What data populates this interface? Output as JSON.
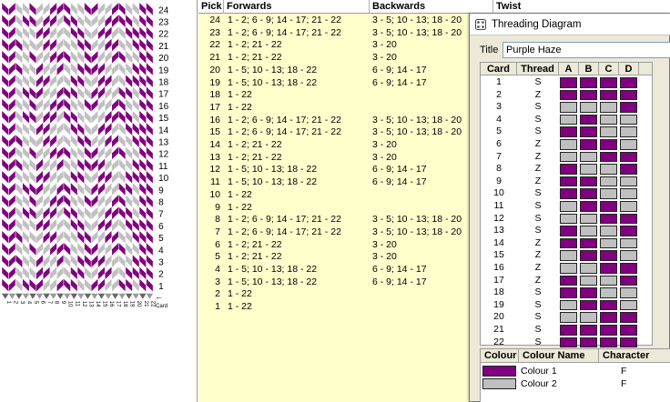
{
  "colors": {
    "purple": "#800080",
    "grey": "#c0c0c0",
    "table_bg": "#ffffcc"
  },
  "pattern": {
    "pick_numbers": [
      "24",
      "23",
      "22",
      "21",
      "20",
      "19",
      "18",
      "17",
      "16",
      "15",
      "14",
      "13",
      "12",
      "11",
      "10",
      "9",
      "8",
      "7",
      "6",
      "5",
      "4",
      "3",
      "2",
      "1"
    ],
    "card_numbers": [
      "1",
      "2",
      "3",
      "4",
      "5",
      "6",
      "7",
      "8",
      "9",
      "10",
      "11",
      "12",
      "13",
      "14",
      "15",
      "16",
      "17",
      "18",
      "19",
      "20",
      "21",
      "22"
    ],
    "card_label": "Card"
  },
  "pick_table": {
    "headers": {
      "pick": "Pick",
      "forwards": "Forwards",
      "backwards": "Backwards",
      "twist": "Twist"
    },
    "rows": [
      {
        "pick": "24",
        "forwards": "1 - 2; 6 - 9; 14 - 17; 21 - 22",
        "backwards": "3 - 5; 10 - 13; 18 - 20"
      },
      {
        "pick": "23",
        "forwards": "1 - 2; 6 - 9; 14 - 17; 21 - 22",
        "backwards": "3 - 5; 10 - 13; 18 - 20"
      },
      {
        "pick": "22",
        "forwards": "1 - 2; 21 - 22",
        "backwards": "3 - 20"
      },
      {
        "pick": "21",
        "forwards": "1 - 2; 21 - 22",
        "backwards": "3 - 20"
      },
      {
        "pick": "20",
        "forwards": "1 - 5; 10 - 13; 18 - 22",
        "backwards": "6 - 9; 14 - 17"
      },
      {
        "pick": "19",
        "forwards": "1 - 5; 10 - 13; 18 - 22",
        "backwards": "6 - 9; 14 - 17"
      },
      {
        "pick": "18",
        "forwards": "1 - 22",
        "backwards": ""
      },
      {
        "pick": "17",
        "forwards": "1 - 22",
        "backwards": ""
      },
      {
        "pick": "16",
        "forwards": "1 - 2; 6 - 9; 14 - 17; 21 - 22",
        "backwards": "3 - 5; 10 - 13; 18 - 20"
      },
      {
        "pick": "15",
        "forwards": "1 - 2; 6 - 9; 14 - 17; 21 - 22",
        "backwards": "3 - 5; 10 - 13; 18 - 20"
      },
      {
        "pick": "14",
        "forwards": "1 - 2; 21 - 22",
        "backwards": "3 - 20"
      },
      {
        "pick": "13",
        "forwards": "1 - 2; 21 - 22",
        "backwards": "3 - 20"
      },
      {
        "pick": "12",
        "forwards": "1 - 5; 10 - 13; 18 - 22",
        "backwards": "6 - 9; 14 - 17"
      },
      {
        "pick": "11",
        "forwards": "1 - 5; 10 - 13; 18 - 22",
        "backwards": "6 - 9; 14 - 17"
      },
      {
        "pick": "10",
        "forwards": "1 - 22",
        "backwards": ""
      },
      {
        "pick": "9",
        "forwards": "1 - 22",
        "backwards": ""
      },
      {
        "pick": "8",
        "forwards": "1 - 2; 6 - 9; 14 - 17; 21 - 22",
        "backwards": "3 - 5; 10 - 13; 18 - 20"
      },
      {
        "pick": "7",
        "forwards": "1 - 2; 6 - 9; 14 - 17; 21 - 22",
        "backwards": "3 - 5; 10 - 13; 18 - 20"
      },
      {
        "pick": "6",
        "forwards": "1 - 2; 21 - 22",
        "backwards": "3 - 20"
      },
      {
        "pick": "5",
        "forwards": "1 - 2; 21 - 22",
        "backwards": "3 - 20"
      },
      {
        "pick": "4",
        "forwards": "1 - 5; 10 - 13; 18 - 22",
        "backwards": "6 - 9; 14 - 17"
      },
      {
        "pick": "3",
        "forwards": "1 - 5; 10 - 13; 18 - 22",
        "backwards": "6 - 9; 14 - 17"
      },
      {
        "pick": "2",
        "forwards": "1 - 22",
        "backwards": ""
      },
      {
        "pick": "1",
        "forwards": "1 - 22",
        "backwards": ""
      }
    ]
  },
  "threading_window": {
    "title": "Threading Diagram",
    "title_label": "Title",
    "title_value": "Purple Haze",
    "headers": {
      "card": "Card",
      "thread": "Thread",
      "a": "A",
      "b": "B",
      "c": "C",
      "d": "D"
    },
    "cards": [
      {
        "card": "1",
        "thread": "S",
        "holes": [
          "P",
          "P",
          "P",
          "P"
        ]
      },
      {
        "card": "2",
        "thread": "Z",
        "holes": [
          "P",
          "P",
          "P",
          "P"
        ]
      },
      {
        "card": "3",
        "thread": "S",
        "holes": [
          "G",
          "G",
          "G",
          "P"
        ]
      },
      {
        "card": "4",
        "thread": "S",
        "holes": [
          "G",
          "P",
          "G",
          "G"
        ]
      },
      {
        "card": "5",
        "thread": "S",
        "holes": [
          "P",
          "P",
          "G",
          "G"
        ]
      },
      {
        "card": "6",
        "thread": "Z",
        "holes": [
          "G",
          "P",
          "P",
          "G"
        ]
      },
      {
        "card": "7",
        "thread": "Z",
        "holes": [
          "G",
          "G",
          "P",
          "P"
        ]
      },
      {
        "card": "8",
        "thread": "Z",
        "holes": [
          "P",
          "G",
          "G",
          "P"
        ]
      },
      {
        "card": "9",
        "thread": "Z",
        "holes": [
          "P",
          "P",
          "G",
          "G"
        ]
      },
      {
        "card": "10",
        "thread": "S",
        "holes": [
          "P",
          "P",
          "G",
          "G"
        ]
      },
      {
        "card": "11",
        "thread": "S",
        "holes": [
          "G",
          "P",
          "P",
          "G"
        ]
      },
      {
        "card": "12",
        "thread": "S",
        "holes": [
          "G",
          "G",
          "P",
          "P"
        ]
      },
      {
        "card": "13",
        "thread": "S",
        "holes": [
          "P",
          "G",
          "G",
          "P"
        ]
      },
      {
        "card": "14",
        "thread": "Z",
        "holes": [
          "P",
          "P",
          "G",
          "G"
        ]
      },
      {
        "card": "15",
        "thread": "Z",
        "holes": [
          "G",
          "P",
          "P",
          "G"
        ]
      },
      {
        "card": "16",
        "thread": "Z",
        "holes": [
          "G",
          "G",
          "P",
          "P"
        ]
      },
      {
        "card": "17",
        "thread": "Z",
        "holes": [
          "P",
          "G",
          "G",
          "P"
        ]
      },
      {
        "card": "18",
        "thread": "S",
        "holes": [
          "P",
          "P",
          "G",
          "G"
        ]
      },
      {
        "card": "19",
        "thread": "S",
        "holes": [
          "G",
          "P",
          "P",
          "G"
        ]
      },
      {
        "card": "20",
        "thread": "S",
        "holes": [
          "G",
          "G",
          "P",
          "P"
        ]
      },
      {
        "card": "21",
        "thread": "S",
        "holes": [
          "P",
          "P",
          "P",
          "P"
        ]
      },
      {
        "card": "22",
        "thread": "S",
        "holes": [
          "P",
          "P",
          "P",
          "P"
        ]
      }
    ],
    "colour_headers": {
      "colour": "Colour",
      "name": "Colour Name",
      "character": "Character"
    },
    "colours": [
      {
        "name": "Colour 1",
        "character": "F",
        "hex": "#800080"
      },
      {
        "name": "Colour 2",
        "character": "F",
        "hex": "#c0c0c0"
      }
    ]
  }
}
